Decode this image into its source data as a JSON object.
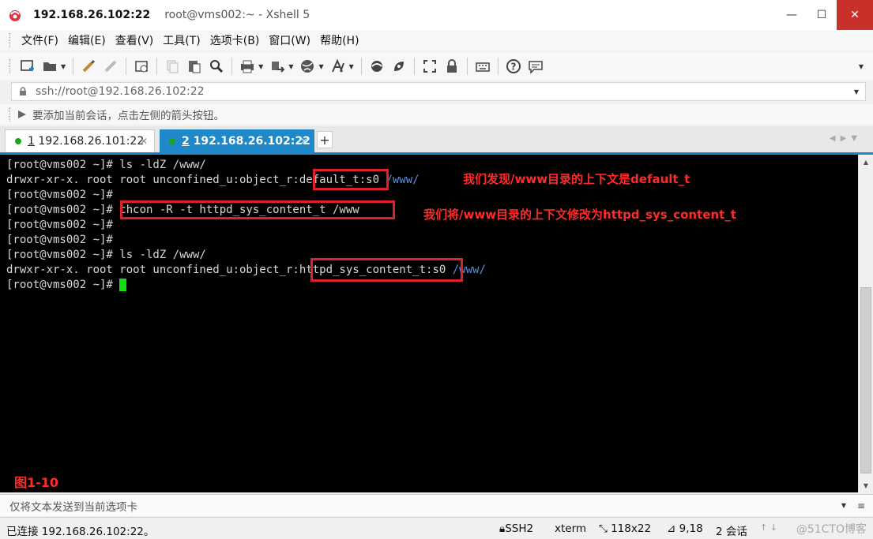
{
  "window": {
    "title_host": "192.168.26.102:22",
    "title_rest": "root@vms002:~ - Xshell 5",
    "minimize": "—",
    "maximize": "☐",
    "close": "✕"
  },
  "menu": [
    "文件(F)",
    "编辑(E)",
    "查看(V)",
    "工具(T)",
    "选项卡(B)",
    "窗口(W)",
    "帮助(H)"
  ],
  "toolbar": {
    "icons": [
      "new-session-icon",
      "open-folder-icon",
      "properties-icon",
      "disconnect-icon",
      "new-window-icon",
      "copy-icon",
      "paste-icon",
      "find-icon",
      "print-icon",
      "transfer-icon",
      "globe-icon",
      "font-icon",
      "xftp-icon",
      "xmanager-icon",
      "fullscreen-icon",
      "lock-icon",
      "keyboard-icon",
      "help-icon",
      "chat-icon"
    ]
  },
  "address": {
    "value": "ssh://root@192.168.26.102:22"
  },
  "hint": {
    "text": "要添加当前会话，点击左侧的箭头按钮。"
  },
  "tabs": [
    {
      "num": "1",
      "label": "192.168.26.101:22",
      "active": false,
      "status_color": "#19a619"
    },
    {
      "num": "2",
      "label": "192.168.26.102:22",
      "active": true,
      "status_color": "#19a619"
    }
  ],
  "tab_add": "+",
  "terminal": {
    "line1": "[root@vms002 ~]# ls -ldZ /www/",
    "line2a": "drwxr-xr-x. root root unconfined_u:object_r:default_t:s0 ",
    "line2b": "/www/",
    "line3": "[root@vms002 ~]#",
    "line4": "[root@vms002 ~]# chcon -R -t httpd_sys_content_t /www",
    "line5": "[root@vms002 ~]#",
    "line6": "[root@vms002 ~]#",
    "line7": "[root@vms002 ~]# ls -ldZ /www/",
    "line8a": "drwxr-xr-x. root root unconfined_u:object_r:httpd_sys_content_t:s0 ",
    "line8b": "/www/",
    "line9": "[root@vms002 ~]# ",
    "cursor_color": "#10e010"
  },
  "annotations": {
    "note1": "我们发现/www目录的上下文是default_t",
    "note2": "我们将/www目录的上下文修改为httpd_sys_content_t",
    "figure_label": "图1-10",
    "color": "#e0202a"
  },
  "sendbar": {
    "placeholder": "仅将文本发送到当前选项卡"
  },
  "status": {
    "connection": "已连接 192.168.26.102:22。",
    "protocol": "SSH2",
    "term": "xterm",
    "size": "118x22",
    "cursor_pos": "9,18",
    "sessions": "2 会话",
    "watermark": "@51CTO博客"
  }
}
